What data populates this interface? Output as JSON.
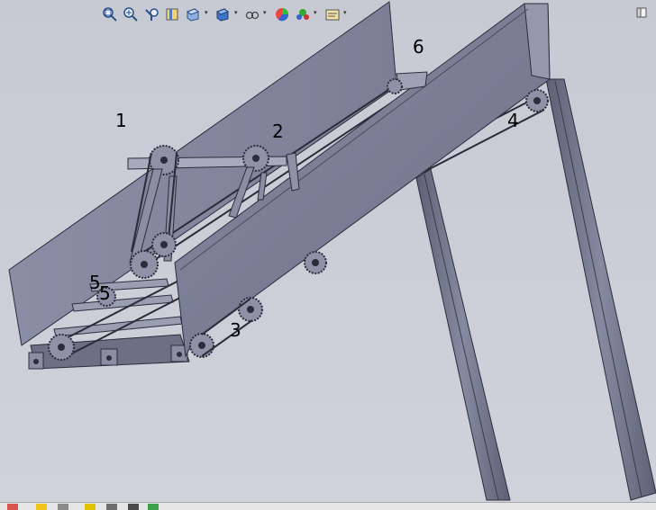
{
  "toolbar": {
    "icons": [
      "zoom-to-fit-icon",
      "zoom-to-area-icon",
      "previous-view-icon",
      "section-view-icon",
      "view-orientation-icon",
      "display-style-icon",
      "hide-show-items-icon",
      "edit-appearance-icon",
      "apply-scene-icon",
      "view-settings-icon"
    ]
  },
  "callouts": {
    "c1": "1",
    "c2": "2",
    "c3": "3",
    "c4": "4",
    "c5a": "5",
    "c5b": "5",
    "c6": "6"
  },
  "colors": {
    "background": "#c9ccd6",
    "frame_face": "#7b7e95",
    "frame_face_dark": "#5d6076",
    "frame_edge": "#2b2d3a",
    "leg": "#73768c"
  },
  "status_bar": {
    "icons": [
      "rebuild-icon",
      "options-icon",
      "help-icon",
      "record-icon",
      "tools-icon",
      "task-icon",
      "view-icon"
    ]
  }
}
